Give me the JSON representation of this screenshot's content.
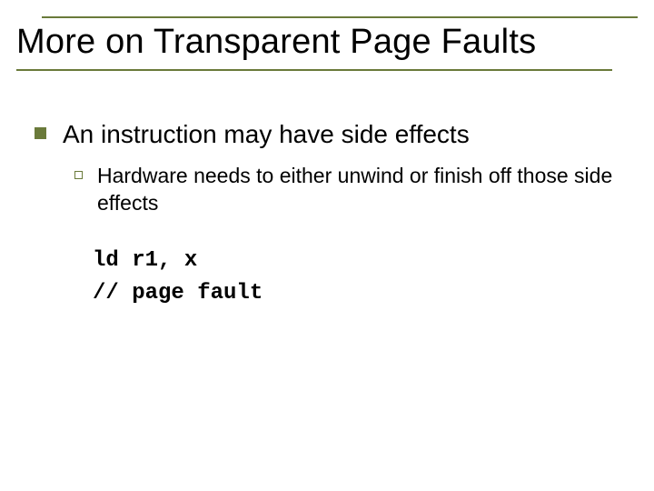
{
  "title": "More on Transparent Page Faults",
  "bullets": {
    "lvl1": "An instruction may have side effects",
    "lvl2": "Hardware needs to either unwind or finish off those side effects"
  },
  "code": {
    "line1": "ld r1, x",
    "line2": "// page fault"
  }
}
